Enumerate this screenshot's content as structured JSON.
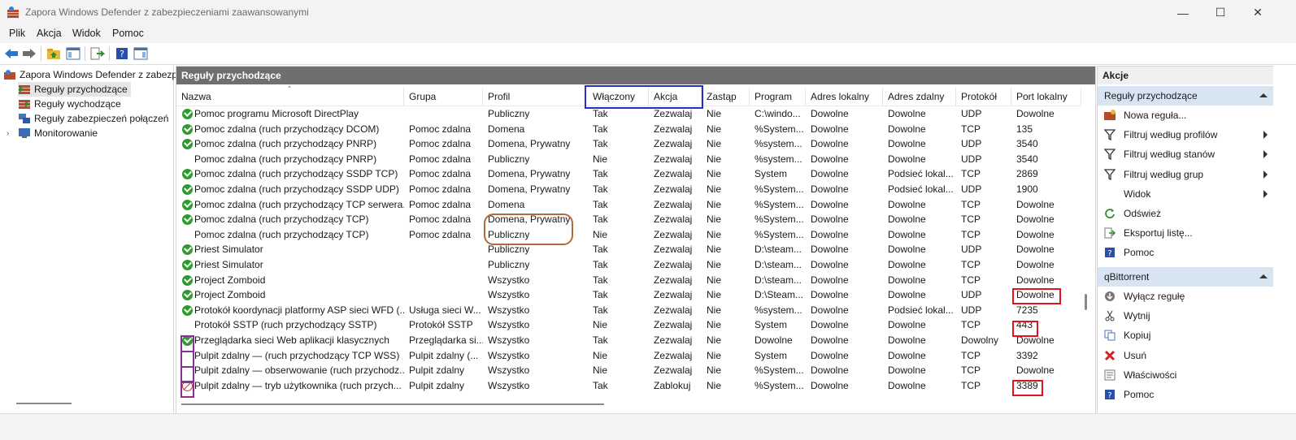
{
  "window": {
    "title": "Zapora Windows Defender z zabezpieczeniami zaawansowanymi"
  },
  "menu": [
    "Plik",
    "Akcja",
    "Widok",
    "Pomoc"
  ],
  "tree": {
    "root": "Zapora Windows Defender z zabezp",
    "items": [
      "Reguły przychodzące",
      "Reguły wychodzące",
      "Reguły zabezpieczeń połączeń",
      "Monitorowanie"
    ]
  },
  "center": {
    "header": "Reguły przychodzące",
    "columns": [
      "Nazwa",
      "Grupa",
      "Profil",
      "Włączony",
      "Akcja",
      "Zastąp",
      "Program",
      "Adres lokalny",
      "Adres zdalny",
      "Protokół",
      "Port lokalny"
    ],
    "rows": [
      {
        "icon": "check",
        "name": "Pomoc programu Microsoft DirectPlay",
        "group": "",
        "profile": "Publiczny",
        "enabled": "Tak",
        "action": "Zezwalaj",
        "override": "Nie",
        "program": "C:\\windo...",
        "local": "Dowolne",
        "remote": "Dowolne",
        "protocol": "UDP",
        "port": "Dowolne"
      },
      {
        "icon": "check",
        "name": "Pomoc zdalna (ruch przychodzący DCOM)",
        "group": "Pomoc zdalna",
        "profile": "Domena",
        "enabled": "Tak",
        "action": "Zezwalaj",
        "override": "Nie",
        "program": "%System...",
        "local": "Dowolne",
        "remote": "Dowolne",
        "protocol": "TCP",
        "port": "135"
      },
      {
        "icon": "check",
        "name": "Pomoc zdalna (ruch przychodzący PNRP)",
        "group": "Pomoc zdalna",
        "profile": "Domena, Prywatny",
        "enabled": "Tak",
        "action": "Zezwalaj",
        "override": "Nie",
        "program": "%system...",
        "local": "Dowolne",
        "remote": "Dowolne",
        "protocol": "UDP",
        "port": "3540"
      },
      {
        "icon": "none",
        "name": "Pomoc zdalna (ruch przychodzący PNRP)",
        "group": "Pomoc zdalna",
        "profile": "Publiczny",
        "enabled": "Nie",
        "action": "Zezwalaj",
        "override": "Nie",
        "program": "%system...",
        "local": "Dowolne",
        "remote": "Dowolne",
        "protocol": "UDP",
        "port": "3540"
      },
      {
        "icon": "check",
        "name": "Pomoc zdalna (ruch przychodzący SSDP TCP)",
        "group": "Pomoc zdalna",
        "profile": "Domena, Prywatny",
        "enabled": "Tak",
        "action": "Zezwalaj",
        "override": "Nie",
        "program": "System",
        "local": "Dowolne",
        "remote": "Podsieć lokal...",
        "protocol": "TCP",
        "port": "2869"
      },
      {
        "icon": "check",
        "name": "Pomoc zdalna (ruch przychodzący SSDP UDP)",
        "group": "Pomoc zdalna",
        "profile": "Domena, Prywatny",
        "enabled": "Tak",
        "action": "Zezwalaj",
        "override": "Nie",
        "program": "%System...",
        "local": "Dowolne",
        "remote": "Podsieć lokal...",
        "protocol": "UDP",
        "port": "1900"
      },
      {
        "icon": "check",
        "name": "Pomoc zdalna (ruch przychodzący TCP serwera...",
        "group": "Pomoc zdalna",
        "profile": "Domena",
        "enabled": "Tak",
        "action": "Zezwalaj",
        "override": "Nie",
        "program": "%System...",
        "local": "Dowolne",
        "remote": "Dowolne",
        "protocol": "TCP",
        "port": "Dowolne"
      },
      {
        "icon": "check",
        "name": "Pomoc zdalna (ruch przychodzący TCP)",
        "group": "Pomoc zdalna",
        "profile": "Domena, Prywatny",
        "enabled": "Tak",
        "action": "Zezwalaj",
        "override": "Nie",
        "program": "%System...",
        "local": "Dowolne",
        "remote": "Dowolne",
        "protocol": "TCP",
        "port": "Dowolne"
      },
      {
        "icon": "none",
        "name": "Pomoc zdalna (ruch przychodzący TCP)",
        "group": "Pomoc zdalna",
        "profile": "Publiczny",
        "enabled": "Nie",
        "action": "Zezwalaj",
        "override": "Nie",
        "program": "%System...",
        "local": "Dowolne",
        "remote": "Dowolne",
        "protocol": "TCP",
        "port": "Dowolne"
      },
      {
        "icon": "check",
        "name": "Priest Simulator",
        "group": "",
        "profile": "Publiczny",
        "enabled": "Tak",
        "action": "Zezwalaj",
        "override": "Nie",
        "program": "D:\\steam...",
        "local": "Dowolne",
        "remote": "Dowolne",
        "protocol": "UDP",
        "port": "Dowolne"
      },
      {
        "icon": "check",
        "name": "Priest Simulator",
        "group": "",
        "profile": "Publiczny",
        "enabled": "Tak",
        "action": "Zezwalaj",
        "override": "Nie",
        "program": "D:\\steam...",
        "local": "Dowolne",
        "remote": "Dowolne",
        "protocol": "TCP",
        "port": "Dowolne"
      },
      {
        "icon": "check",
        "name": "Project Zomboid",
        "group": "",
        "profile": "Wszystko",
        "enabled": "Tak",
        "action": "Zezwalaj",
        "override": "Nie",
        "program": "D:\\steam...",
        "local": "Dowolne",
        "remote": "Dowolne",
        "protocol": "TCP",
        "port": "Dowolne"
      },
      {
        "icon": "check",
        "name": "Project Zomboid",
        "group": "",
        "profile": "Wszystko",
        "enabled": "Tak",
        "action": "Zezwalaj",
        "override": "Nie",
        "program": "D:\\Steam...",
        "local": "Dowolne",
        "remote": "Dowolne",
        "protocol": "UDP",
        "port": "Dowolne"
      },
      {
        "icon": "check",
        "name": "Protokół koordynacji platformy ASP sieci WFD (...",
        "group": "Usługa sieci W...",
        "profile": "Wszystko",
        "enabled": "Tak",
        "action": "Zezwalaj",
        "override": "Nie",
        "program": "%system...",
        "local": "Dowolne",
        "remote": "Podsieć lokal...",
        "protocol": "UDP",
        "port": "7235"
      },
      {
        "icon": "none",
        "name": "Protokół SSTP (ruch przychodzący SSTP)",
        "group": "Protokół SSTP",
        "profile": "Wszystko",
        "enabled": "Nie",
        "action": "Zezwalaj",
        "override": "Nie",
        "program": "System",
        "local": "Dowolne",
        "remote": "Dowolne",
        "protocol": "TCP",
        "port": "443"
      },
      {
        "icon": "check",
        "name": "Przeglądarka sieci Web aplikacji klasycznych",
        "group": "Przeglądarka si...",
        "profile": "Wszystko",
        "enabled": "Tak",
        "action": "Zezwalaj",
        "override": "Nie",
        "program": "Dowolne",
        "local": "Dowolne",
        "remote": "Dowolne",
        "protocol": "Dowolny",
        "port": "Dowolne"
      },
      {
        "icon": "none",
        "name": "Pulpit zdalny — (ruch przychodzący TCP WSS)",
        "group": "Pulpit zdalny (...",
        "profile": "Wszystko",
        "enabled": "Nie",
        "action": "Zezwalaj",
        "override": "Nie",
        "program": "System",
        "local": "Dowolne",
        "remote": "Dowolne",
        "protocol": "TCP",
        "port": "3392"
      },
      {
        "icon": "none",
        "name": "Pulpit zdalny — obserwowanie (ruch przychodz...",
        "group": "Pulpit zdalny",
        "profile": "Wszystko",
        "enabled": "Nie",
        "action": "Zezwalaj",
        "override": "Nie",
        "program": "%System...",
        "local": "Dowolne",
        "remote": "Dowolne",
        "protocol": "TCP",
        "port": "Dowolne"
      },
      {
        "icon": "block",
        "name": "Pulpit zdalny — tryb użytkownika (ruch przych...",
        "group": "Pulpit zdalny",
        "profile": "Wszystko",
        "enabled": "Tak",
        "action": "Zablokuj",
        "override": "Nie",
        "program": "%System...",
        "local": "Dowolne",
        "remote": "Dowolne",
        "protocol": "TCP",
        "port": "3389"
      }
    ]
  },
  "actions": {
    "title": "Akcje",
    "section1": "Reguły przychodzące",
    "items1": [
      {
        "label": "Nowa reguła...",
        "icon": "new-rule-icon",
        "arrow": false
      },
      {
        "label": "Filtruj według profilów",
        "icon": "filter-icon",
        "arrow": true
      },
      {
        "label": "Filtruj według stanów",
        "icon": "filter-icon",
        "arrow": true
      },
      {
        "label": "Filtruj według grup",
        "icon": "filter-icon",
        "arrow": true
      },
      {
        "label": "Widok",
        "icon": "",
        "arrow": true
      },
      {
        "label": "Odśwież",
        "icon": "refresh-icon",
        "arrow": false
      },
      {
        "label": "Eksportuj listę...",
        "icon": "export-icon",
        "arrow": false
      },
      {
        "label": "Pomoc",
        "icon": "help-icon",
        "arrow": false
      }
    ],
    "section2": "qBittorrent",
    "items2": [
      {
        "label": "Wyłącz regułę",
        "icon": "disable-rule-icon"
      },
      {
        "label": "Wytnij",
        "icon": "cut-icon"
      },
      {
        "label": "Kopiuj",
        "icon": "copy-icon"
      },
      {
        "label": "Usuń",
        "icon": "delete-icon"
      },
      {
        "label": "Właściwości",
        "icon": "properties-icon"
      },
      {
        "label": "Pomoc",
        "icon": "help-icon"
      }
    ]
  }
}
